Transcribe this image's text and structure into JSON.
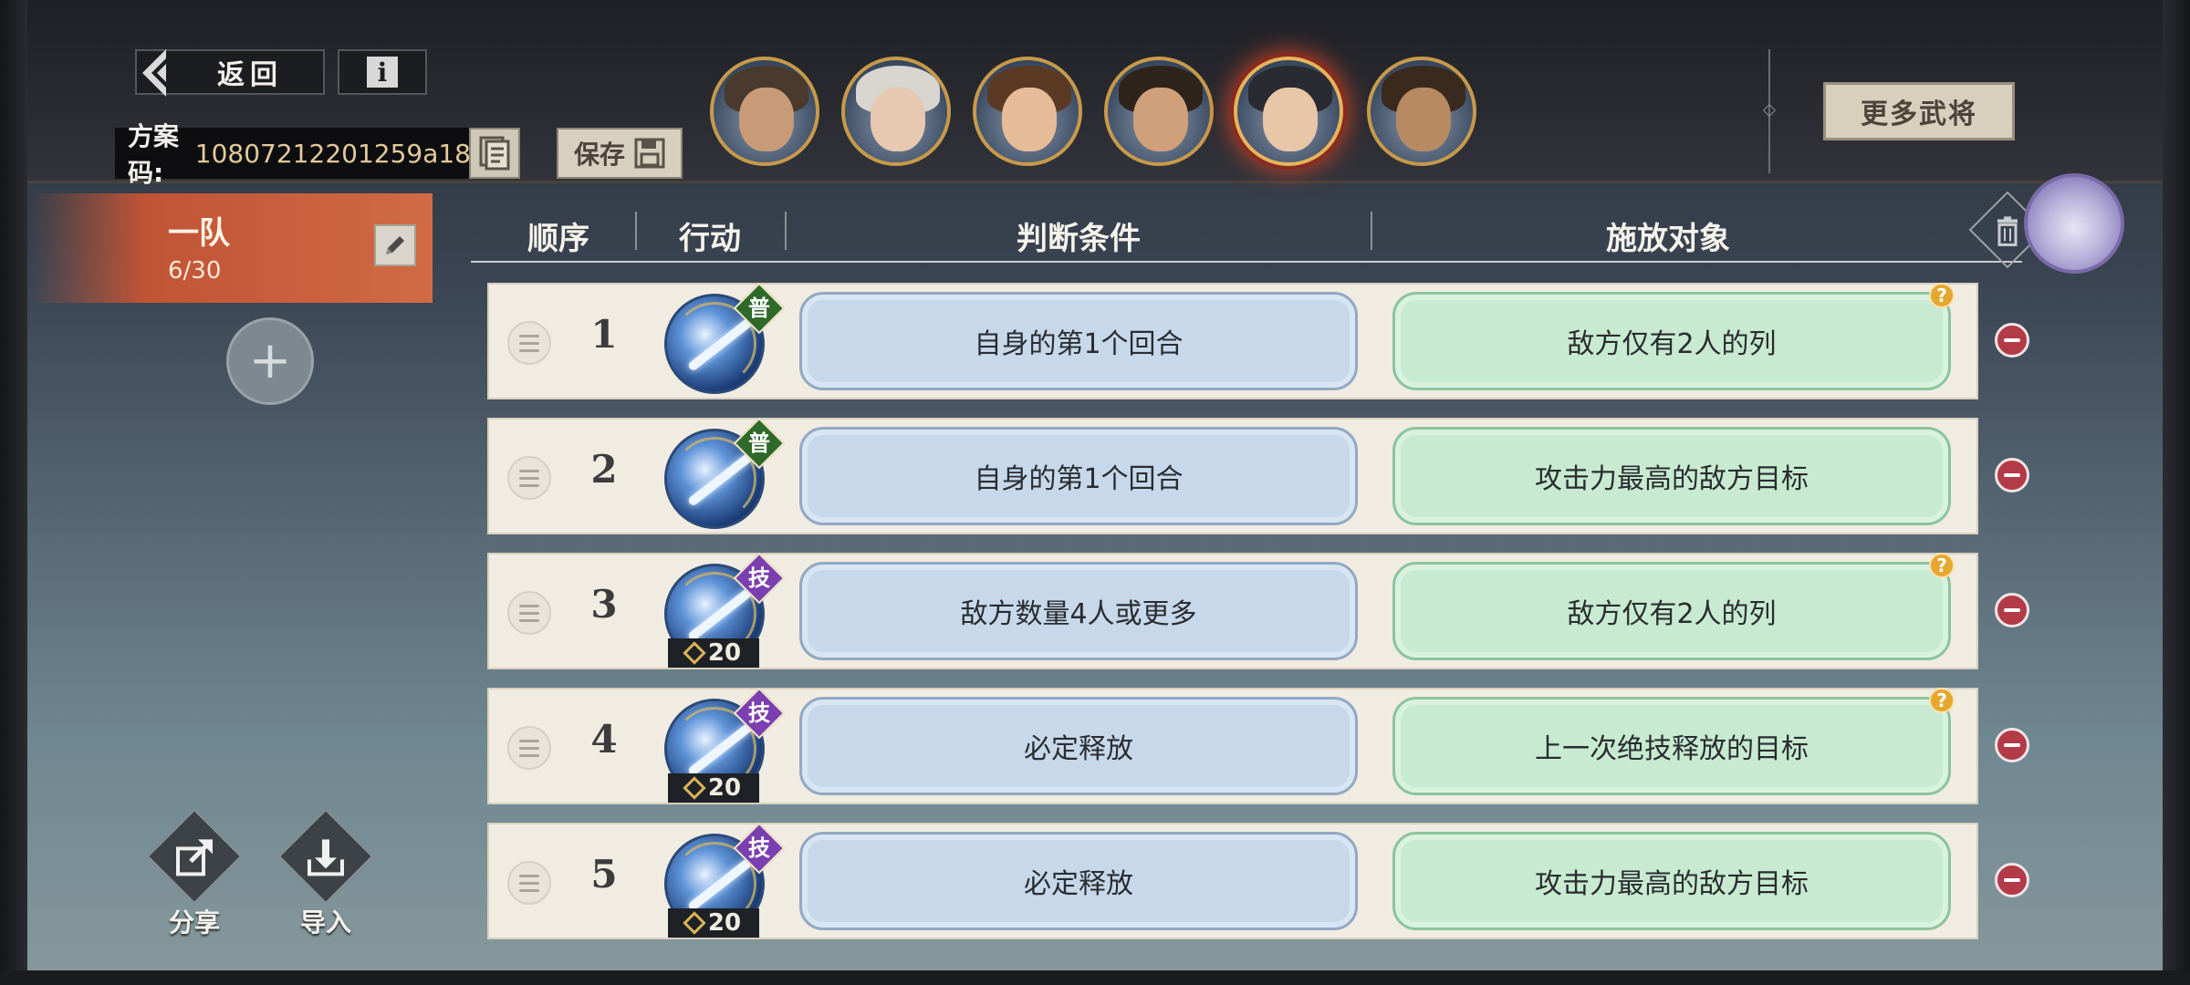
{
  "header": {
    "back_label": "返回",
    "info_label": "i",
    "plan_code_label": "方案码:",
    "plan_code_value": "10807212201259a18",
    "save_label": "保存",
    "more_heroes_label": "更多武将"
  },
  "heroes": [
    {
      "name": "hero-1",
      "selected": false,
      "hair": "#4a3a2e",
      "face": "#c89a78"
    },
    {
      "name": "hero-2",
      "selected": false,
      "hair": "#d8d4d0",
      "face": "#e7c8b0"
    },
    {
      "name": "hero-3",
      "selected": false,
      "hair": "#5a3a24",
      "face": "#e6bc98"
    },
    {
      "name": "hero-4",
      "selected": false,
      "hair": "#2e241c",
      "face": "#cfa07a"
    },
    {
      "name": "hero-5",
      "selected": true,
      "hair": "#2a2a32",
      "face": "#e8c6a8"
    },
    {
      "name": "hero-6",
      "selected": false,
      "hair": "#3a2a1e",
      "face": "#b88a62"
    }
  ],
  "team": {
    "name": "一队",
    "count": "6/30"
  },
  "bottom_actions": {
    "share_label": "分享",
    "import_label": "导入"
  },
  "table": {
    "headers": {
      "order": "顺序",
      "action": "行动",
      "condition": "判断条件",
      "target": "施放对象"
    },
    "rows": [
      {
        "order": "1",
        "badge": "普",
        "badge_type": "normal",
        "cost": "",
        "condition": "自身的第1个回合",
        "target": "敌方仅有2人的列",
        "help": "?"
      },
      {
        "order": "2",
        "badge": "普",
        "badge_type": "normal",
        "cost": "",
        "condition": "自身的第1个回合",
        "target": "攻击力最高的敌方目标",
        "help": ""
      },
      {
        "order": "3",
        "badge": "技",
        "badge_type": "skill",
        "cost": "20",
        "condition": "敌方数量4人或更多",
        "target": "敌方仅有2人的列",
        "help": "?"
      },
      {
        "order": "4",
        "badge": "技",
        "badge_type": "skill",
        "cost": "20",
        "condition": "必定释放",
        "target": "上一次绝技释放的目标",
        "help": "?"
      },
      {
        "order": "5",
        "badge": "技",
        "badge_type": "skill",
        "cost": "20",
        "condition": "必定释放",
        "target": "攻击力最高的敌方目标",
        "help": ""
      }
    ]
  }
}
